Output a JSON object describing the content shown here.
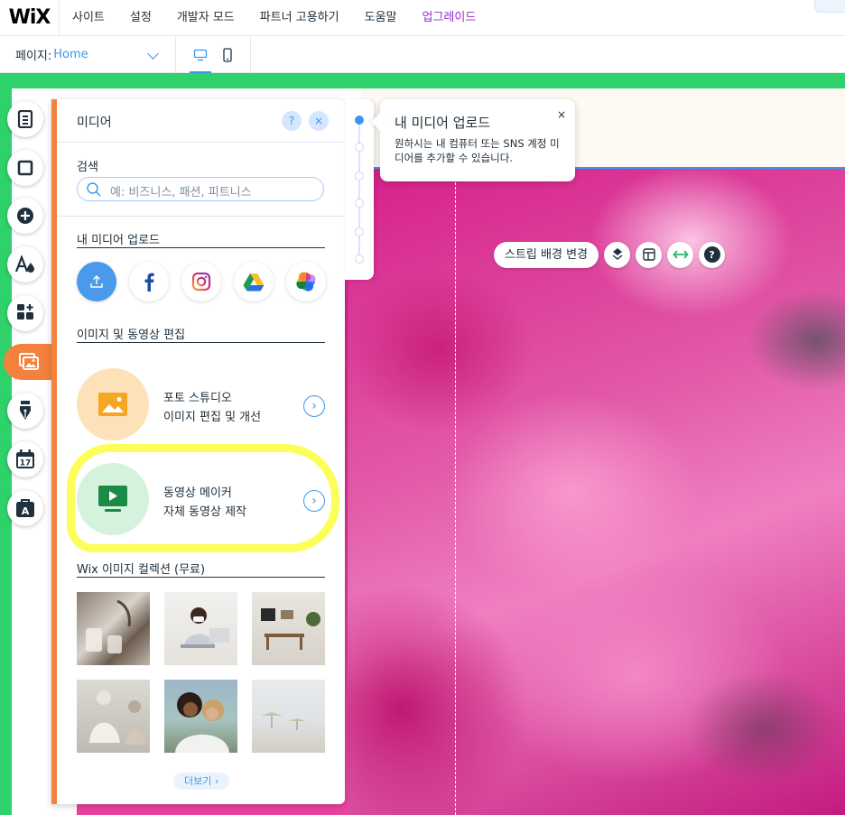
{
  "topbar": {
    "logo": "WiX",
    "menu": [
      "사이트",
      "설정",
      "개발자 모드",
      "파트너 고용하기",
      "도움말",
      "업그레이드"
    ]
  },
  "pagebar": {
    "page_label": "페이지:",
    "page_value": "Home"
  },
  "media_panel": {
    "title": "미디어",
    "help_label": "?",
    "close_label": "×",
    "search_label": "검색",
    "search_placeholder": "예: 비즈니스, 패션, 피트니스",
    "upload_section": "내 미디어 업로드",
    "edit_section": "이미지 및 동영상 편집",
    "tools": [
      {
        "title": "포토 스튜디오",
        "subtitle": "이미지 편집 및 개선"
      },
      {
        "title": "동영상 메이커",
        "subtitle": "자체 동영상 제작"
      }
    ],
    "collection_section": "Wix 이미지 컬렉션 (무료)",
    "more_button": "더보기 ›"
  },
  "tooltip": {
    "title": "내 미디어 업로드",
    "body": "원하시는 내 컴퓨터 또는 SNS 계정 미디어를 추가할 수 있습니다.",
    "close": "×"
  },
  "strip_toolbar": {
    "change_bg": "스트립 배경 변경",
    "help": "?"
  },
  "colors": {
    "accent": "#3899ec",
    "panel_accent": "#f4813d",
    "canvas_border": "#2fd16a",
    "highlight": "#fbff3d",
    "upgrade": "#9a27d5"
  }
}
